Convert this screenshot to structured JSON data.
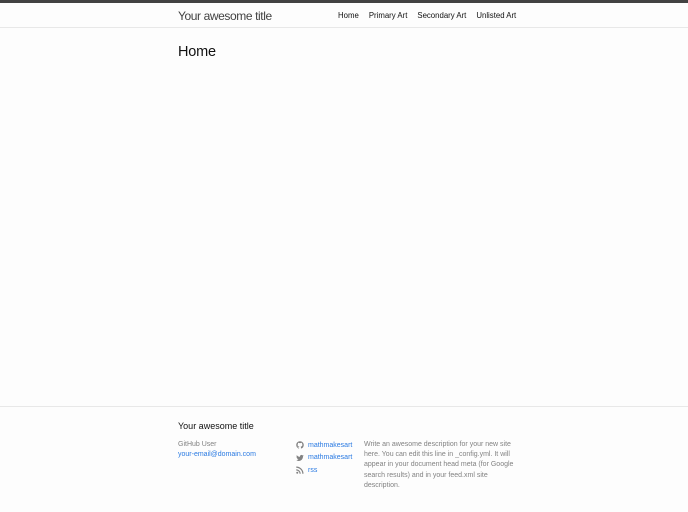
{
  "header": {
    "site_title": "Your awesome title",
    "nav": [
      "Home",
      "Primary Art",
      "Secondary Art",
      "Unlisted Art"
    ]
  },
  "main": {
    "heading": "Home"
  },
  "footer": {
    "heading": "Your awesome title",
    "name": "GitHub User",
    "email": "your-email@domain.com",
    "social": [
      {
        "icon": "github-icon",
        "label": "mathmakesart"
      },
      {
        "icon": "twitter-icon",
        "label": "mathmakesart"
      },
      {
        "icon": "rss-icon",
        "label": "rss"
      }
    ],
    "description": "Write an awesome description for your new site here. You can edit this line in _config.yml. It will appear in your document head meta (for Google search results) and in your feed.xml site description."
  },
  "colors": {
    "link": "#2a7ae2",
    "muted": "#828282",
    "topbar": "#424242"
  }
}
